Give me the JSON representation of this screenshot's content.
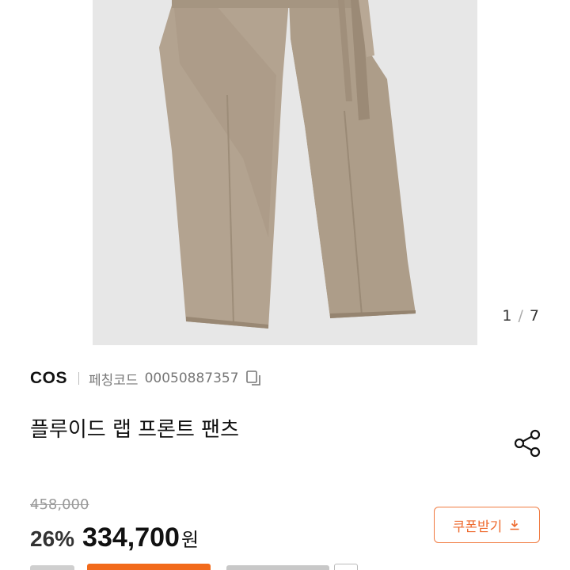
{
  "gallery": {
    "current": "1",
    "separator": "/",
    "total": "7"
  },
  "brand": "COS",
  "product_code": {
    "label": "페칭코드",
    "value": "00050887357"
  },
  "title": "플루이드 랩 프론트 팬츠",
  "pricing": {
    "original": "458,000",
    "discount": "26%",
    "price": "334,700",
    "currency": "원",
    "coupon_label": "쿠폰받기"
  },
  "colors": {
    "coupon_accent": "#ee6a2e",
    "product_fabric": "#b3a390"
  }
}
